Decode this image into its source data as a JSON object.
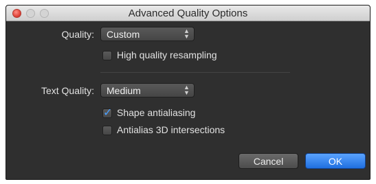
{
  "window": {
    "title": "Advanced Quality Options"
  },
  "quality": {
    "label": "Quality:",
    "selected": "Custom",
    "high_quality_resampling": {
      "label": "High quality resampling",
      "checked": false
    }
  },
  "text_quality": {
    "label": "Text Quality:",
    "selected": "Medium",
    "shape_antialiasing": {
      "label": "Shape antialiasing",
      "checked": true
    },
    "antialias_3d": {
      "label": "Antialias 3D intersections",
      "checked": false
    }
  },
  "buttons": {
    "cancel": "Cancel",
    "ok": "OK"
  },
  "icons": {
    "checkmark": "✓",
    "popup_arrows": "▲▼"
  },
  "colors": {
    "accent": "#2f7cf0",
    "panel": "#2f2f2f"
  }
}
